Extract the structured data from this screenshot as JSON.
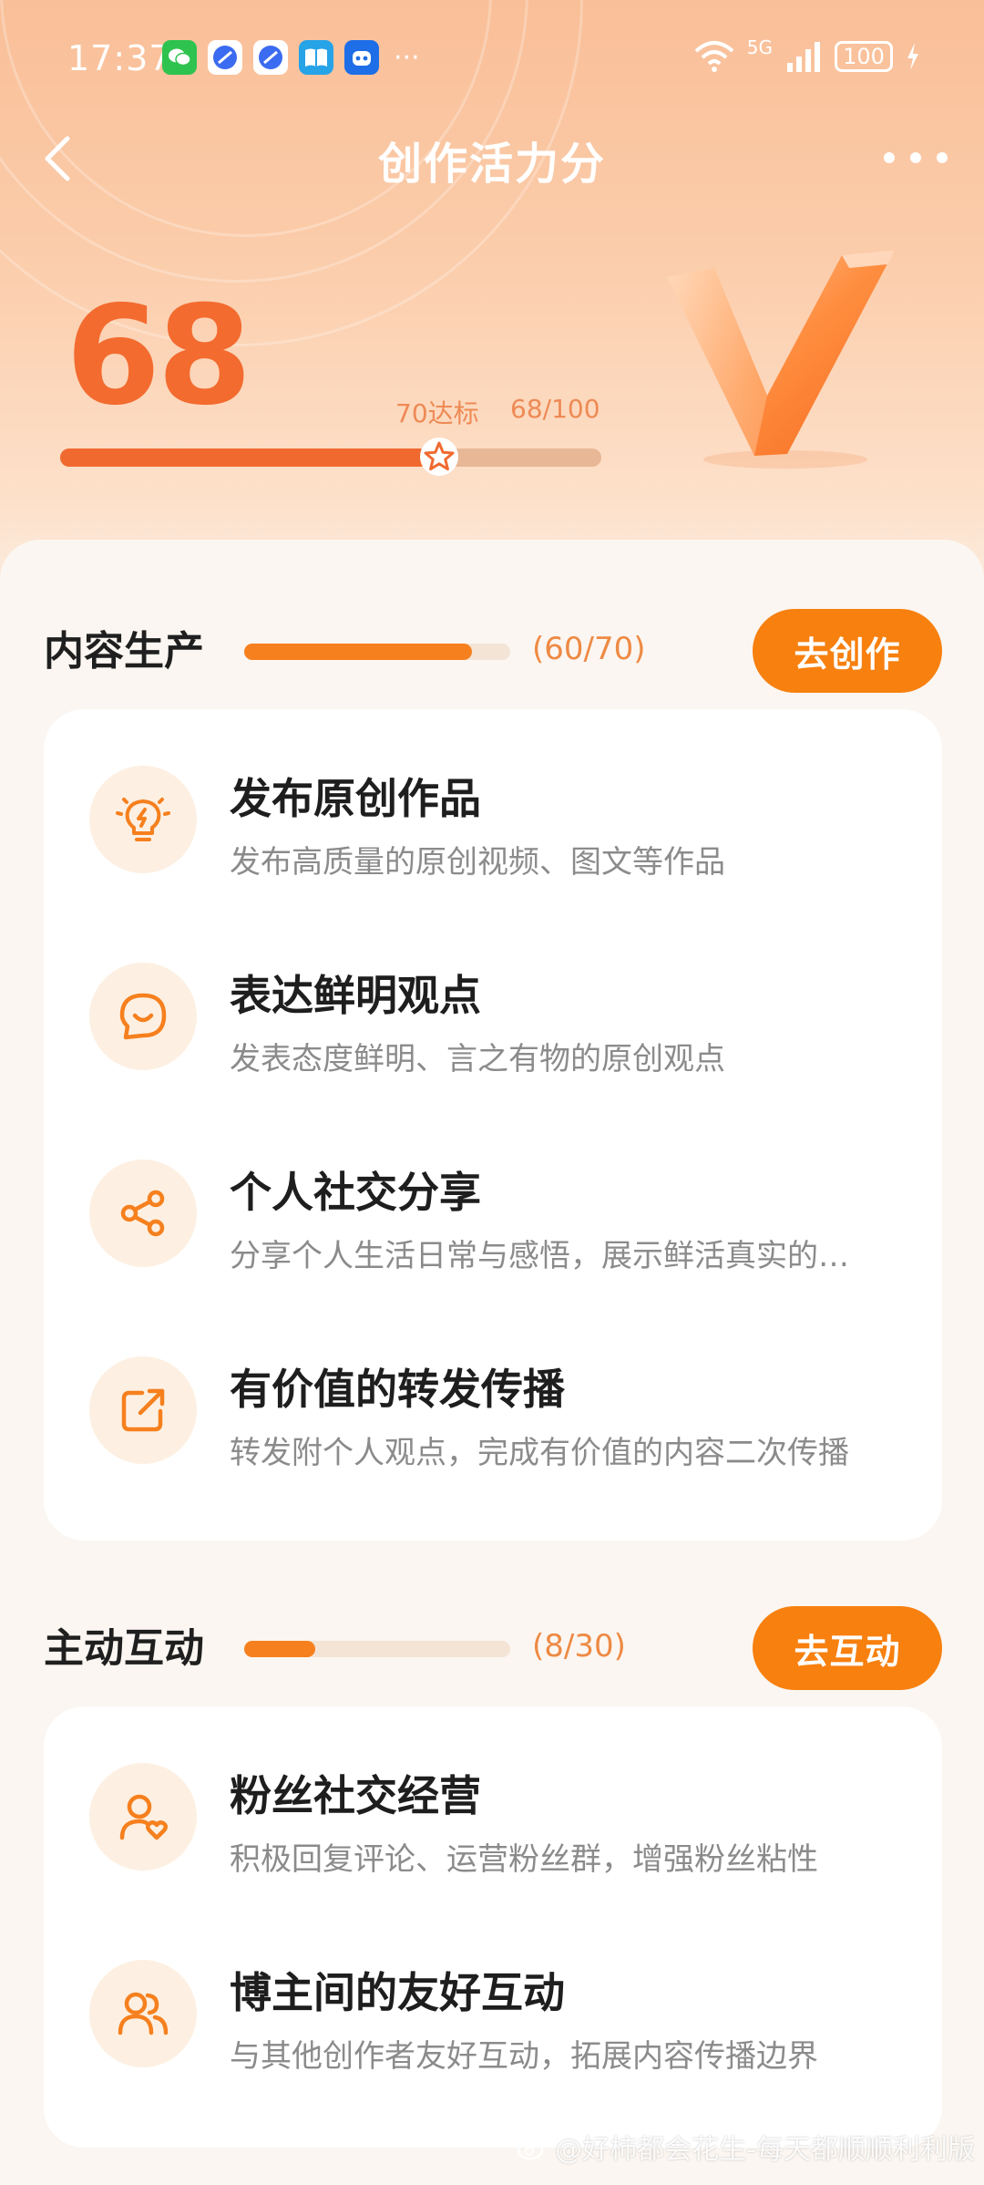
{
  "status_bar": {
    "time": "17:37",
    "more": "···",
    "network": "5G",
    "battery": "100"
  },
  "nav": {
    "title": "创作活力分"
  },
  "score": {
    "value": "68",
    "target_label": "70达标",
    "ratio_label": "68/100",
    "progress": 0.68,
    "target": 0.7
  },
  "sections": {
    "content": {
      "label": "内容生产",
      "count": "(60/70)",
      "progress": 0.857,
      "button": "去创作",
      "items": [
        {
          "title": "发布原创作品",
          "desc": "发布高质量的原创视频、图文等作品",
          "icon": "lightbulb-icon"
        },
        {
          "title": "表达鲜明观点",
          "desc": "发表态度鲜明、言之有物的原创观点",
          "icon": "chat-smile-icon"
        },
        {
          "title": "个人社交分享",
          "desc": "分享个人生活日常与感悟，展示鲜活真实的…",
          "icon": "share-icon"
        },
        {
          "title": "有价值的转发传播",
          "desc": "转发附个人观点，完成有价值的内容二次传播",
          "icon": "forward-icon"
        }
      ]
    },
    "interact": {
      "label": "主动互动",
      "count": "(8/30)",
      "progress": 0.267,
      "button": "去互动",
      "items": [
        {
          "title": "粉丝社交经营",
          "desc": "积极回复评论、运营粉丝群，增强粉丝粘性",
          "icon": "user-heart-icon"
        },
        {
          "title": "博主间的友好互动",
          "desc": "与其他创作者友好互动，拓展内容传播边界",
          "icon": "users-icon"
        }
      ]
    }
  },
  "watermark": "@好柿都会花生-每天都顺顺利利版",
  "colors": {
    "accent": "#f7800f",
    "score": "#f36b2f",
    "icon_bg": "#fdf0e2"
  }
}
